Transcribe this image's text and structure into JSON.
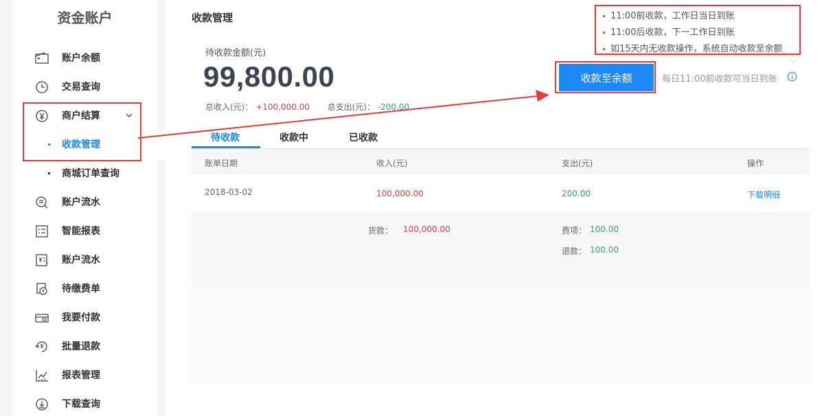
{
  "sidebar": {
    "title": "资金账户",
    "items": [
      {
        "label": "账户余额",
        "icon": "wallet-icon"
      },
      {
        "label": "交易查询",
        "icon": "clock-icon"
      },
      {
        "label": "商户结算",
        "icon": "yen-circle-icon"
      },
      {
        "label": "收款管理",
        "sub": true,
        "active": true
      },
      {
        "label": "商城订单查询",
        "sub": true
      },
      {
        "label": "账户流水",
        "icon": "search-list-icon"
      },
      {
        "label": "智能报表",
        "icon": "report-list-icon"
      },
      {
        "label": "账户流水",
        "icon": "ledger-icon"
      },
      {
        "label": "待缴费单",
        "icon": "bill-icon"
      },
      {
        "label": "我要付款",
        "icon": "card-icon"
      },
      {
        "label": "批量退款",
        "icon": "refund-icon"
      },
      {
        "label": "报表管理",
        "icon": "chart-icon"
      },
      {
        "label": "下载查询",
        "icon": "download-icon"
      }
    ]
  },
  "main": {
    "title": "收款管理",
    "pending_label": "待收款金额(元)",
    "amount": "99,800.00",
    "total_income_label": "总收入(元)：",
    "total_income_value": "+100,000.00",
    "total_expense_label": "总支出(元)：",
    "total_expense_value": "-200.00",
    "collect_button": "收款至余额",
    "button_hint": "每日11:00前收款可当日到账",
    "tips": [
      "11:00前收款，工作日当日到账",
      "11:00后收款，下一工作日到账",
      "如15天内无收款操作，系统自动收款至余额"
    ],
    "tabs": [
      "待收款",
      "收款中",
      "已收款"
    ],
    "table": {
      "headers": [
        "账单日期",
        "收入(元)",
        "支出(元)",
        "操作"
      ],
      "row": {
        "date": "2018-03-02",
        "income": "100,000.00",
        "expense": "200.00",
        "action": "下载明细"
      },
      "detail": {
        "goods_label": "货款：",
        "goods_value": "100,000.00",
        "fee_label": "费项：",
        "fee_value": "100.00",
        "refund_label": "退款：",
        "refund_value": "100.00"
      }
    }
  },
  "colors": {
    "accent": "#1e88e5",
    "income": "#e23c3c",
    "expense": "#2aa86a",
    "annotation": "#e03c3c"
  }
}
